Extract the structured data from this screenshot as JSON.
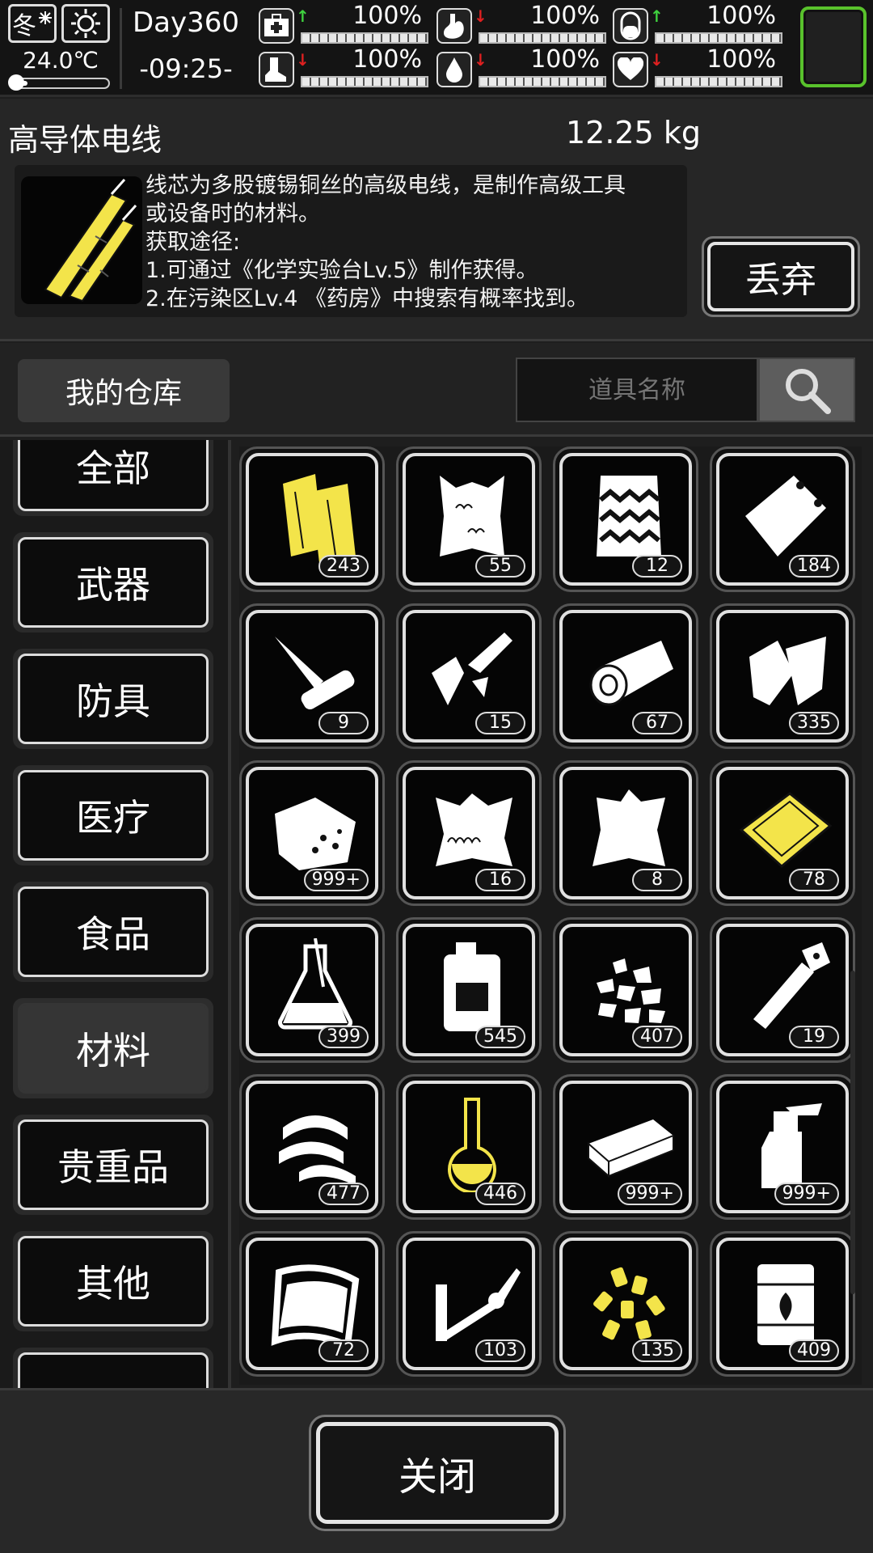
{
  "status": {
    "season": "冬",
    "temperature": "24.0℃",
    "thermometer_level": 0.15,
    "day": "Day360",
    "time": "-09:25-",
    "stats": [
      {
        "icon": "medkit-icon",
        "trend": "up",
        "value": "100%"
      },
      {
        "icon": "stomach-icon",
        "trend": "down",
        "value": "100%"
      },
      {
        "icon": "pill-icon",
        "trend": "up",
        "value": "100%"
      },
      {
        "icon": "boot-icon",
        "trend": "down",
        "value": "100%"
      },
      {
        "icon": "water-drop-icon",
        "trend": "down",
        "value": "100%"
      },
      {
        "icon": "heart-icon",
        "trend": "down",
        "value": "100%"
      }
    ]
  },
  "detail": {
    "name": "高导体电线",
    "weight": "12.25 kg",
    "lines": [
      "线芯为多股镀锡铜丝的高级电线，是制作高级工具",
      "或设备时的材料。",
      "获取途径:",
      "1.可通过《化学实验台Lv.5》制作获得。",
      "2.在污染区Lv.4 《药房》中搜索有概率找到。"
    ],
    "drop_label": "丢弃"
  },
  "storage": {
    "tab_label": "我的仓库",
    "search_placeholder": "道具名称"
  },
  "categories": [
    {
      "label": "全部",
      "active": false
    },
    {
      "label": "武器",
      "active": false
    },
    {
      "label": "防具",
      "active": false
    },
    {
      "label": "医疗",
      "active": false
    },
    {
      "label": "食品",
      "active": false
    },
    {
      "label": "材料",
      "active": true
    },
    {
      "label": "贵重品",
      "active": false
    },
    {
      "label": "其他",
      "active": false
    }
  ],
  "items": [
    {
      "icon": "wood-planks-icon",
      "qty": "243",
      "color": "#f3e44a"
    },
    {
      "icon": "fur-pelt-icon",
      "qty": "55",
      "color": "#ffffff"
    },
    {
      "icon": "striped-pelt-icon",
      "qty": "12",
      "color": "#ffffff"
    },
    {
      "icon": "plastic-sheet-icon",
      "qty": "184",
      "color": "#ffffff"
    },
    {
      "icon": "folding-knife-icon",
      "qty": "9",
      "color": "#ffffff"
    },
    {
      "icon": "scrap-parts-icon",
      "qty": "15",
      "color": "#ffffff"
    },
    {
      "icon": "log-icon",
      "qty": "67",
      "color": "#ffffff"
    },
    {
      "icon": "cloth-scraps-icon",
      "qty": "335",
      "color": "#ffffff"
    },
    {
      "icon": "ore-sack-icon",
      "qty": "999+",
      "color": "#ffffff"
    },
    {
      "icon": "hide-icon",
      "qty": "16",
      "color": "#ffffff"
    },
    {
      "icon": "leather-icon",
      "qty": "8",
      "color": "#ffffff"
    },
    {
      "icon": "gold-plate-icon",
      "qty": "78",
      "color": "#f3e44a"
    },
    {
      "icon": "flask-icon",
      "qty": "399",
      "color": "#ffffff"
    },
    {
      "icon": "jerrycan-icon",
      "qty": "545",
      "color": "#ffffff"
    },
    {
      "icon": "gravel-icon",
      "qty": "407",
      "color": "#ffffff"
    },
    {
      "icon": "metal-rod-icon",
      "qty": "19",
      "color": "#ffffff"
    },
    {
      "icon": "tape-roll-icon",
      "qty": "477",
      "color": "#ffffff"
    },
    {
      "icon": "volumetric-flask-icon",
      "qty": "446",
      "color": "#f3e44a"
    },
    {
      "icon": "brick-icon",
      "qty": "999+",
      "color": "#ffffff"
    },
    {
      "icon": "spray-bottle-icon",
      "qty": "999+",
      "color": "#ffffff"
    },
    {
      "icon": "glass-sheet-icon",
      "qty": "72",
      "color": "#ffffff"
    },
    {
      "icon": "soldering-iron-icon",
      "qty": "103",
      "color": "#ffffff"
    },
    {
      "icon": "yellow-pellets-icon",
      "qty": "135",
      "color": "#f3e44a"
    },
    {
      "icon": "oil-barrel-icon",
      "qty": "409",
      "color": "#ffffff"
    }
  ],
  "close_label": "关闭"
}
